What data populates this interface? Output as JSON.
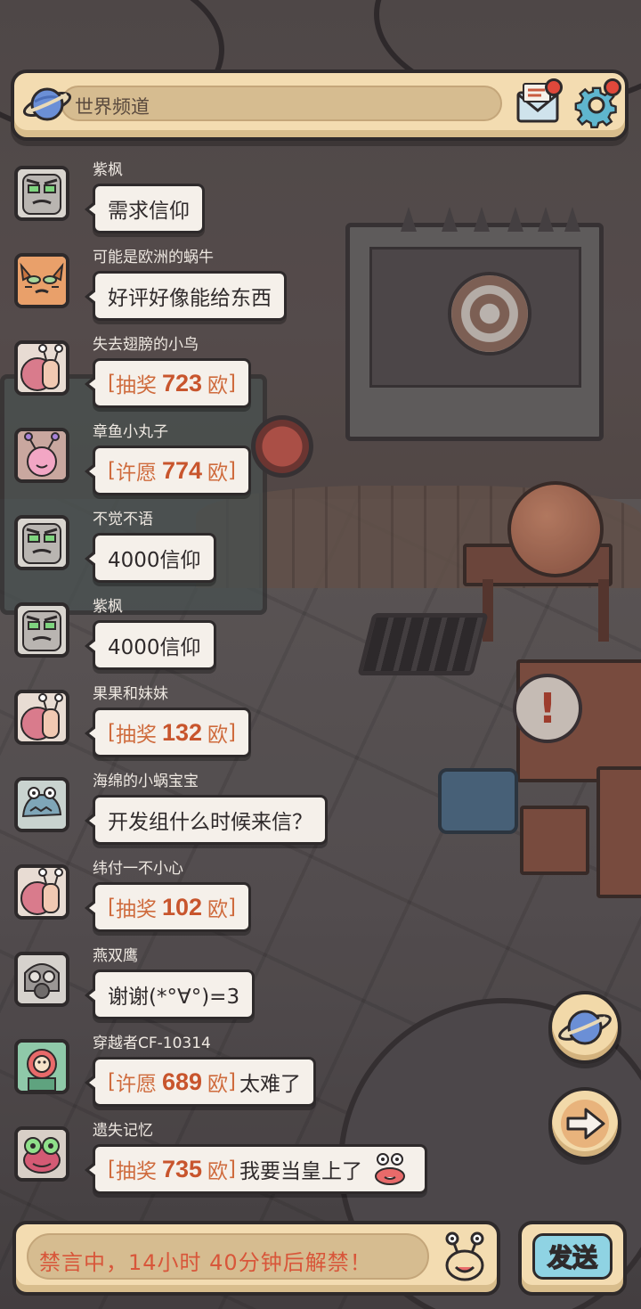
{
  "header": {
    "channel_title": "世界频道",
    "mail_icon": "mail-icon",
    "settings_icon": "gear-icon",
    "channel_icon": "planet-icon",
    "notification_color": "#e0483b"
  },
  "messages": [
    {
      "user": "紫枫",
      "avatar": "gray-robot-face",
      "type": "text",
      "text": "需求信仰"
    },
    {
      "user": "可能是欧洲的蜗牛",
      "avatar": "orange-cat",
      "type": "text",
      "text": "好评好像能给东西"
    },
    {
      "user": "失去翅膀的小鸟",
      "avatar": "snail",
      "type": "lottery",
      "open": "[",
      "action": "抽奖",
      "amount": "723",
      "unit": "欧",
      "close": "]",
      "extra": ""
    },
    {
      "user": "章鱼小丸子",
      "avatar": "pink-snail",
      "type": "lottery",
      "open": "[",
      "action": "许愿",
      "amount": "774",
      "unit": "欧",
      "close": "]",
      "extra": ""
    },
    {
      "user": "不觉不语",
      "avatar": "gray-robot-face",
      "type": "text",
      "text": "4000信仰"
    },
    {
      "user": "紫枫",
      "avatar": "gray-robot-face",
      "type": "text",
      "text": "4000信仰"
    },
    {
      "user": "果果和妹妹",
      "avatar": "snail",
      "type": "lottery",
      "open": "[",
      "action": "抽奖",
      "amount": "132",
      "unit": "欧",
      "close": "]",
      "extra": ""
    },
    {
      "user": "海绵的小蜗宝宝",
      "avatar": "blue-monster",
      "type": "text",
      "text": "开发组什么时候来信？"
    },
    {
      "user": "纬付一不小心",
      "avatar": "snail",
      "type": "lottery",
      "open": "[",
      "action": "抽奖",
      "amount": "102",
      "unit": "欧",
      "close": "]",
      "extra": ""
    },
    {
      "user": "燕双鹰",
      "avatar": "gas-mask",
      "type": "text",
      "text": "谢谢(*°∀°)=3"
    },
    {
      "user": "穿越者CF-10314",
      "avatar": "green-suit",
      "type": "lottery",
      "open": "[",
      "action": "许愿",
      "amount": "689",
      "unit": "欧",
      "close": "]",
      "extra": "太难了"
    },
    {
      "user": "遗失记忆",
      "avatar": "green-frog",
      "type": "lottery",
      "open": "[",
      "action": "抽奖",
      "amount": "735",
      "unit": "欧",
      "close": "]",
      "extra": "我要当皇上了",
      "emoji": "crab-emoji"
    }
  ],
  "side_buttons": {
    "planet": "planet-icon",
    "next": "arrow-right-icon"
  },
  "footer": {
    "mute_text": "禁言中，14小时  40分钟后解禁！",
    "emoji_icon": "snail-face-icon",
    "send_label": "发送"
  },
  "colors": {
    "lottery_text": "#cf6b3d",
    "mute_text": "#d8563a",
    "send_button": "#8fd3e3",
    "panel": "#f3dcb1"
  }
}
